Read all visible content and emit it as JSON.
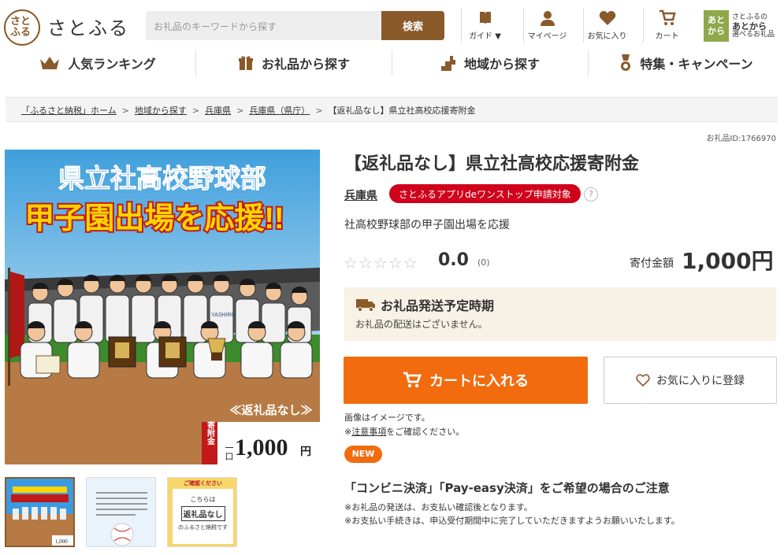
{
  "header": {
    "logo_mark": "さとふる",
    "logo_text": "さとふる",
    "search_placeholder": "お礼品のキーワードから探す",
    "search_button": "検索",
    "icons": {
      "guide": "ガイド ▼",
      "mypage": "マイページ",
      "favorites": "お気に入り",
      "cart": "カート"
    },
    "app_badge": {
      "square": "あと から",
      "line1": "さとふるの",
      "line2": "あとから",
      "line3": "選べるお礼品"
    }
  },
  "nav": {
    "ranking": "人気ランキング",
    "gifts": "お礼品から探す",
    "region": "地域から探す",
    "campaign": "特集・キャンペーン"
  },
  "breadcrumb": {
    "items": [
      "「ふるさと納税」ホーム",
      "地域から探す",
      "兵庫県",
      "兵庫県（県庁）"
    ],
    "current": "【返礼品なし】県立社高校応援寄附金"
  },
  "item_id": "お礼品ID:1766970",
  "main_image": {
    "headline1": "県立社高校野球部",
    "headline2": "甲子園出場を応援!!",
    "no_gift": "≪返礼品なし≫",
    "donation_label": "寄附金",
    "donation_unit_prefix": "一口",
    "donation_amount": "1,000",
    "donation_unit": "円",
    "team_text": "YASHIRO"
  },
  "thumbnails": {
    "t3_top": "ご確認ください",
    "t3_line1": "こちらは",
    "t3_line2": "返礼品なし",
    "t3_line3": "のふるさと納税です",
    "t1_amount": "1,000"
  },
  "product": {
    "title": "【返礼品なし】県立社高校応援寄附金",
    "prefecture": "兵庫県",
    "app_tag": "さとふるアプリdeワンストップ申請対象",
    "help": "?",
    "subtitle": "社高校野球部の甲子園出場を応援",
    "stars": "☆☆☆☆☆",
    "rating": "0.0",
    "rating_count": "(0)",
    "price_label": "寄付金額",
    "price": "1,000円"
  },
  "shipping": {
    "title": "お礼品発送予定時期",
    "text": "お礼品の配送はございません。"
  },
  "buttons": {
    "cart": "カートに入れる",
    "favorite": "お気に入りに登録"
  },
  "notes": {
    "image_note": "画像はイメージです。",
    "caution_prefix": "※",
    "caution_link": "注意事項",
    "caution_suffix": "をご確認ください。",
    "new_badge": "NEW"
  },
  "notice": {
    "title": "「コンビニ決済」「Pay-easy決済」をご希望の場合のご注意",
    "line1": "※お礼品の発送は、お支払い確認後となります。",
    "line2": "※お支払い手続きは、申込受付期間中に完了していただきますようお願いいたします。"
  },
  "colors": {
    "brand": "#8a5a2b",
    "cart": "#f26b0f",
    "app_tag": "#d0021b",
    "ship_bg": "#f7f1e6"
  }
}
